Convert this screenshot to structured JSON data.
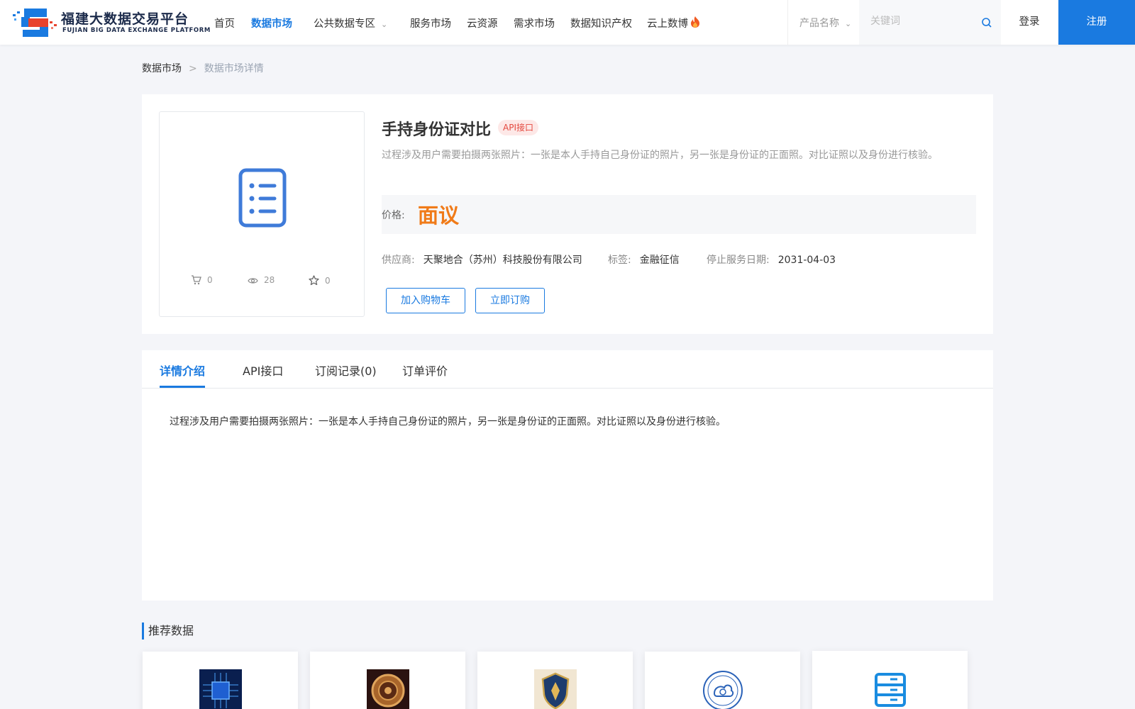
{
  "header": {
    "logo": {
      "cn": "福建大数据交易平台",
      "en": "FUJIAN BIG DATA EXCHANGE  PLATFORM"
    },
    "nav": [
      "首页",
      "数据市场",
      "公共数据专区",
      "服务市场",
      "云资源",
      "需求市场",
      "数据知识产权",
      "云上数博"
    ],
    "active_nav": "数据市场",
    "search": {
      "category": "产品名称",
      "placeholder": "关键词"
    },
    "login_label": "登录",
    "register_label": "注册"
  },
  "breadcrumb": {
    "parent": "数据市场",
    "separator": ">",
    "current": "数据市场详情"
  },
  "product": {
    "title": "手持身份证对比",
    "badge": "API接口",
    "description": "过程涉及用户需要拍摄两张照片：一张是本人手持自己身份证的照片，另一张是身份证的正面照。对比证照以及身份进行核验。",
    "price_label": "价格:",
    "price": "面议",
    "supplier_label": "供应商:",
    "supplier": "天聚地合（苏州）科技股份有限公司",
    "tag_label": "标签:",
    "tag": "金融征信",
    "end_date_label": "停止服务日期:",
    "end_date": "2031-04-03",
    "add_cart_label": "加入购物车",
    "buy_label": "立即订购",
    "stats": {
      "cart": "0",
      "views": "28",
      "favorites": "0"
    }
  },
  "tabs": {
    "items": [
      "详情介绍",
      "API接口",
      "订阅记录(0)",
      "订单评价"
    ],
    "active": "详情介绍",
    "content": "过程涉及用户需要拍摄两张照片：一张是本人手持自己身份证的照片，另一张是身份证的正面照。对比证照以及身份进行核验。"
  },
  "recommend": {
    "title": "推荐数据",
    "cards": [
      "circuit-image",
      "coin-image",
      "shield-emblem-image",
      "weather-bureau-logo",
      "server-icon"
    ]
  },
  "colors": {
    "accent": "#1a7ae0",
    "price": "#f07b19",
    "badge_text": "#e4483e",
    "badge_bg": "#fde8e7",
    "page_bg": "#f4f5f9"
  }
}
